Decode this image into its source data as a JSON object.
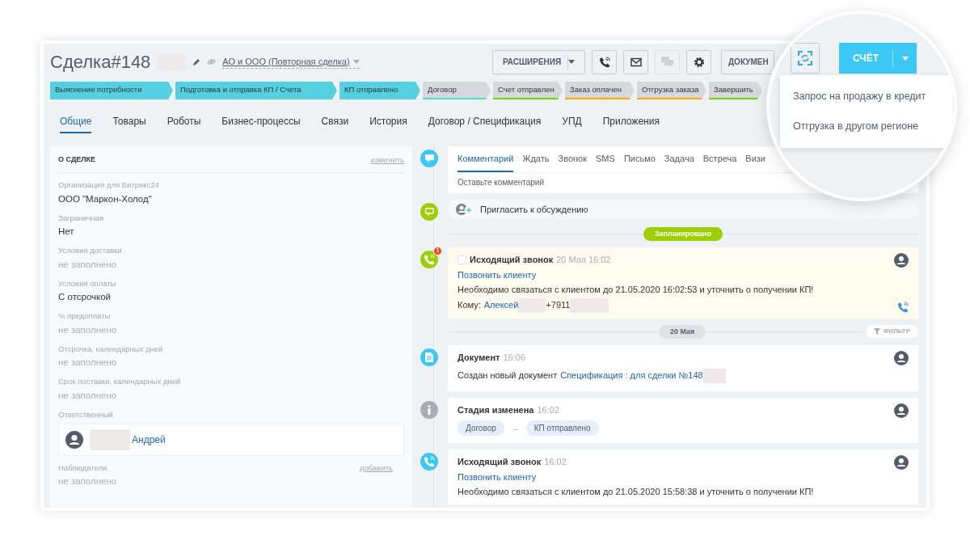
{
  "header": {
    "title": "Сделка#148",
    "category": "АО и ООО (Повторная сделка)"
  },
  "toolbar": {
    "extensions": "РАСШИРЕНИЯ",
    "icon_buttons": [
      {
        "kind": "phone",
        "disabled": false
      },
      {
        "kind": "mail",
        "disabled": false
      },
      {
        "kind": "chat",
        "disabled": true
      },
      {
        "kind": "gear",
        "disabled": false
      }
    ],
    "documents": "ДОКУМЕН",
    "invoice": "СЧЁТ"
  },
  "invoice_menu": [
    "Запрос на продажу в кредит",
    "Отгрузка в другом регионе"
  ],
  "stages": [
    {
      "label": "Выяснение потребности",
      "passed": true,
      "color": "#55d0e0"
    },
    {
      "label": "Подготовка и отправка КП / Счета",
      "passed": true,
      "color": "#55d0e0"
    },
    {
      "label": "КП отправлено",
      "passed": true,
      "color": "#55d0e0"
    },
    {
      "label": "Договор",
      "passed": false,
      "color": "#47e4c2"
    },
    {
      "label": "Счет отправлен",
      "passed": false,
      "color": "#7bd500"
    },
    {
      "label": "Заказ оплачен",
      "passed": false,
      "color": "#ffa900"
    },
    {
      "label": "Отгрузка заказа",
      "passed": false,
      "color": "#ffa900"
    },
    {
      "label": "Завершить",
      "passed": false,
      "color": "#7bd500"
    }
  ],
  "tabs": [
    {
      "label": "Общие",
      "selected": true
    },
    {
      "label": "Товары",
      "selected": false
    },
    {
      "label": "Роботы",
      "selected": false
    },
    {
      "label": "Бизнес-процессы",
      "selected": false
    },
    {
      "label": "Связи",
      "selected": false
    },
    {
      "label": "История",
      "selected": false
    },
    {
      "label": "Договор / Спецификация",
      "selected": false
    },
    {
      "label": "УПД",
      "selected": false
    },
    {
      "label": "Приложения",
      "selected": false
    }
  ],
  "about": {
    "title": "О СДЕЛКЕ",
    "edit": "изменить",
    "fields": [
      {
        "label": "Организация для Битрикс24",
        "value": "ООО \"Маркон-Холод\"",
        "filled": true
      },
      {
        "label": "Заграничная",
        "value": "Нет",
        "filled": true
      },
      {
        "label": "Условия доставки",
        "value": "не заполнено",
        "filled": false
      },
      {
        "label": "Условия оплаты",
        "value": "С отсрочкой",
        "filled": true
      },
      {
        "label": "% предоплаты",
        "value": "не заполнено",
        "filled": false
      },
      {
        "label": "Отсрочка, календарных дней",
        "value": "не заполнено",
        "filled": false
      },
      {
        "label": "Срок поставки, календарных дней",
        "value": "не заполнено",
        "filled": false
      }
    ],
    "responsible": {
      "label": "Ответственный",
      "name": "Андрей"
    },
    "observers": {
      "label": "Наблюдатели",
      "add": "добавить",
      "value": "не заполнено"
    }
  },
  "timeline": {
    "composer": {
      "tabs": [
        {
          "label": "Комментарий",
          "selected": true
        },
        {
          "label": "Ждать",
          "selected": false
        },
        {
          "label": "Звонок",
          "selected": false
        },
        {
          "label": "SMS",
          "selected": false
        },
        {
          "label": "Письмо",
          "selected": false
        },
        {
          "label": "Задача",
          "selected": false
        },
        {
          "label": "Встреча",
          "selected": false
        },
        {
          "label": "Визи",
          "selected": false
        }
      ],
      "placeholder": "Оставьте комментарий"
    },
    "invite": "Пригласить к обсуждению",
    "planned": "Запланировано",
    "planned_items": [
      {
        "kind": "call",
        "checked": false,
        "counter": "1",
        "title": "Исходящий звонок",
        "time": "20 Мая 16:02",
        "link": "Позвонить клиенту",
        "text": "Необходимо связаться с клиентом до 21.05.2020 16:02:53 и уточнить о получении КП!",
        "to_label": "Кому:",
        "to_name": "Алексей",
        "phone": "+7911"
      }
    ],
    "date": "20 Мая",
    "filter": "ФИЛЬТР",
    "history": [
      {
        "kind": "document",
        "title": "Документ",
        "time": "16:06",
        "text": "Создан новый документ",
        "link": "Спецификация : для сделки №148"
      },
      {
        "kind": "stage",
        "title": "Стадия изменена",
        "time": "16:02",
        "from": "Договор",
        "arrow": "→",
        "to": "КП отправлено"
      },
      {
        "kind": "call",
        "title": "Исходящий звонок",
        "time": "16:02",
        "link": "Позвонить клиенту",
        "text": "Необходимо связаться с клиентом до 21.05.2020 15:58:38 и уточнить о получении КП!"
      }
    ]
  }
}
